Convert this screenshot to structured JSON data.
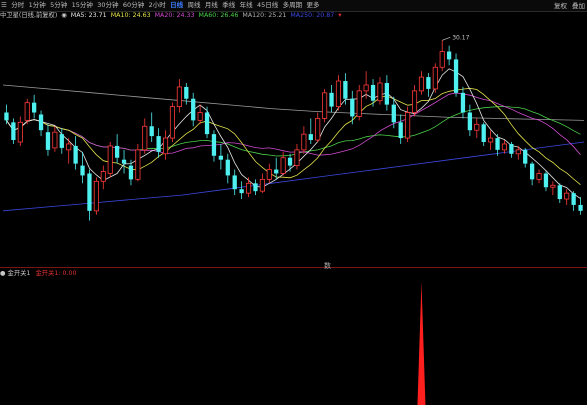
{
  "toolbar": {
    "tabs": [
      {
        "label": "分时",
        "active": false
      },
      {
        "label": "1分钟",
        "active": false
      },
      {
        "label": "5分钟",
        "active": false
      },
      {
        "label": "15分钟",
        "active": false
      },
      {
        "label": "30分钟",
        "active": false
      },
      {
        "label": "60分钟",
        "active": false
      },
      {
        "label": "2小时",
        "active": false
      },
      {
        "label": "日线",
        "active": true
      },
      {
        "label": "周线",
        "active": false
      },
      {
        "label": "月线",
        "active": false
      },
      {
        "label": "季线",
        "active": false
      },
      {
        "label": "年线",
        "active": false
      },
      {
        "label": "45日线",
        "active": false
      },
      {
        "label": "多周期",
        "active": false
      },
      {
        "label": "更多",
        "active": false
      }
    ],
    "right": [
      "复权",
      "叠加"
    ]
  },
  "ma_legend": {
    "title": "中卫星(日线,前复权)",
    "items": [
      {
        "label": "MA5: 23.71",
        "color": "#e6e6e6"
      },
      {
        "label": "MA10: 24.63",
        "color": "#e3e34a"
      },
      {
        "label": "MA20: 24.33",
        "color": "#d24bd2"
      },
      {
        "label": "MA60: 26.46",
        "color": "#4bd24b"
      },
      {
        "label": "MA120: 25.21",
        "color": "#b0b0b0"
      },
      {
        "label": "MA250: 20.87",
        "color": "#3a48e0"
      }
    ]
  },
  "high_label": "30.17",
  "indicator": {
    "name": "金开关1",
    "param": "金开关1: 0.00",
    "name_color": "#c8c8c8",
    "param_color": "#e03030"
  },
  "scroll_glyph": "数",
  "colors": {
    "up": "#ff3a3a",
    "down": "#4ff0f0",
    "spike": "#ff1f1f",
    "divider": "#7a1515",
    "ma5": "#e6e6e6",
    "ma10": "#e3e34a",
    "ma20": "#d24bd2",
    "ma60": "#4bd24b",
    "ma120": "#9c9c9c",
    "ma250": "#3a48e0",
    "active_tab": "#3c7dff"
  },
  "chart_data": {
    "type": "candlestick",
    "candles": [
      [
        26.5,
        26.9,
        25.9,
        26.1
      ],
      [
        26.0,
        26.2,
        24.9,
        25.1
      ],
      [
        25.0,
        26.3,
        24.8,
        26.0
      ],
      [
        26.1,
        27.2,
        25.9,
        27.0
      ],
      [
        27.0,
        27.4,
        26.2,
        26.5
      ],
      [
        26.4,
        26.6,
        25.3,
        25.6
      ],
      [
        25.5,
        25.9,
        24.3,
        24.6
      ],
      [
        24.7,
        25.8,
        24.5,
        25.5
      ],
      [
        25.4,
        25.7,
        24.4,
        24.7
      ],
      [
        24.6,
        25.2,
        23.9,
        24.9
      ],
      [
        24.8,
        25.3,
        23.6,
        23.9
      ],
      [
        23.8,
        24.5,
        22.9,
        23.3
      ],
      [
        23.4,
        23.6,
        21.0,
        21.5
      ],
      [
        21.5,
        23.2,
        21.3,
        23.0
      ],
      [
        23.0,
        23.8,
        22.6,
        23.5
      ],
      [
        23.4,
        25.0,
        23.2,
        24.8
      ],
      [
        24.8,
        25.4,
        23.9,
        24.2
      ],
      [
        24.1,
        24.6,
        23.4,
        23.9
      ],
      [
        23.8,
        24.1,
        22.8,
        23.1
      ],
      [
        23.1,
        24.9,
        23.0,
        24.6
      ],
      [
        24.6,
        26.2,
        24.4,
        25.8
      ],
      [
        25.8,
        26.5,
        25.0,
        25.3
      ],
      [
        25.3,
        25.7,
        24.2,
        24.5
      ],
      [
        24.4,
        25.6,
        24.1,
        25.2
      ],
      [
        25.2,
        27.0,
        25.0,
        26.8
      ],
      [
        26.8,
        28.2,
        26.5,
        27.8
      ],
      [
        27.8,
        28.0,
        26.9,
        27.2
      ],
      [
        27.2,
        27.5,
        25.8,
        26.1
      ],
      [
        26.1,
        26.9,
        25.9,
        26.5
      ],
      [
        26.5,
        26.8,
        25.2,
        25.4
      ],
      [
        25.4,
        25.6,
        24.0,
        24.3
      ],
      [
        24.3,
        24.9,
        23.6,
        24.1
      ],
      [
        24.1,
        24.4,
        22.9,
        23.3
      ],
      [
        23.3,
        23.6,
        22.3,
        22.6
      ],
      [
        22.6,
        23.0,
        22.1,
        22.4
      ],
      [
        22.4,
        23.2,
        22.2,
        22.9
      ],
      [
        22.9,
        23.1,
        22.3,
        22.5
      ],
      [
        22.5,
        23.4,
        22.4,
        23.1
      ],
      [
        23.1,
        23.9,
        22.9,
        23.6
      ],
      [
        23.6,
        24.2,
        23.1,
        23.4
      ],
      [
        23.4,
        24.5,
        23.3,
        24.2
      ],
      [
        24.2,
        24.4,
        23.5,
        23.8
      ],
      [
        23.8,
        24.9,
        23.6,
        24.6
      ],
      [
        24.6,
        25.8,
        24.4,
        25.4
      ],
      [
        25.4,
        26.2,
        24.9,
        25.1
      ],
      [
        25.1,
        26.5,
        25.0,
        26.2
      ],
      [
        26.2,
        27.7,
        26.0,
        27.5
      ],
      [
        27.5,
        27.9,
        26.5,
        26.8
      ],
      [
        26.8,
        28.4,
        26.6,
        28.1
      ],
      [
        28.1,
        28.5,
        26.9,
        27.2
      ],
      [
        27.2,
        27.6,
        25.9,
        26.3
      ],
      [
        26.3,
        27.9,
        26.1,
        27.6
      ],
      [
        27.6,
        28.6,
        27.2,
        27.9
      ],
      [
        27.9,
        28.2,
        26.8,
        27.1
      ],
      [
        27.1,
        28.3,
        26.9,
        28.0
      ],
      [
        28.0,
        28.4,
        26.6,
        26.9
      ],
      [
        26.9,
        27.3,
        25.7,
        26.0
      ],
      [
        26.0,
        26.4,
        24.9,
        25.2
      ],
      [
        25.2,
        26.8,
        25.0,
        26.5
      ],
      [
        26.5,
        27.9,
        26.3,
        27.6
      ],
      [
        27.6,
        28.6,
        27.4,
        28.3
      ],
      [
        28.3,
        28.5,
        27.3,
        27.7
      ],
      [
        27.7,
        29.0,
        27.5,
        28.8
      ],
      [
        28.8,
        30.17,
        28.6,
        29.6
      ],
      [
        29.6,
        29.9,
        28.9,
        29.2
      ],
      [
        29.2,
        29.5,
        27.3,
        27.5
      ],
      [
        27.5,
        27.8,
        26.2,
        26.5
      ],
      [
        26.5,
        26.9,
        25.3,
        25.6
      ],
      [
        25.6,
        26.2,
        25.2,
        25.9
      ],
      [
        25.9,
        26.0,
        24.8,
        25.0
      ],
      [
        25.0,
        25.6,
        24.6,
        25.2
      ],
      [
        25.2,
        25.4,
        24.3,
        24.6
      ],
      [
        24.6,
        25.1,
        24.4,
        24.9
      ],
      [
        24.9,
        25.0,
        24.2,
        24.4
      ],
      [
        24.4,
        24.8,
        24.1,
        24.6
      ],
      [
        24.6,
        24.7,
        23.7,
        23.9
      ],
      [
        23.9,
        24.0,
        22.8,
        23.1
      ],
      [
        23.1,
        23.6,
        22.9,
        23.4
      ],
      [
        23.4,
        23.5,
        22.5,
        22.7
      ],
      [
        22.7,
        23.0,
        22.3,
        22.8
      ],
      [
        22.8,
        22.9,
        21.9,
        22.1
      ],
      [
        22.1,
        22.6,
        21.8,
        22.4
      ],
      [
        22.4,
        22.5,
        21.5,
        21.8
      ],
      [
        21.8,
        22.2,
        21.3,
        21.5
      ]
    ],
    "ylim": [
      19.0,
      31.0
    ],
    "ma_bands": {
      "ma120": [
        27.9,
        27.7,
        27.5,
        27.3,
        27.1,
        26.9,
        26.7,
        26.55,
        26.45,
        26.35,
        26.25,
        26.2,
        26.15,
        26.1
      ],
      "ma250": [
        21.5,
        21.7,
        21.9,
        22.1,
        22.3,
        22.6,
        22.9,
        23.2,
        23.5,
        23.8,
        24.1,
        24.4,
        24.7,
        25.0
      ]
    },
    "indicator_spike": {
      "x_index": 60,
      "value": 1.0,
      "ylim": [
        0,
        1.0
      ]
    }
  }
}
